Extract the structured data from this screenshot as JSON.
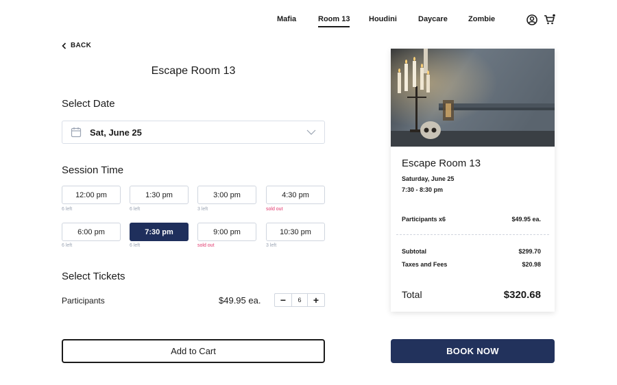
{
  "nav": {
    "items": [
      {
        "label": "Mafia"
      },
      {
        "label": "Room 13"
      },
      {
        "label": "Houdini"
      },
      {
        "label": "Daycare"
      },
      {
        "label": "Zombie"
      }
    ],
    "active": "Room 13",
    "icons": [
      "account-icon",
      "cart-icon"
    ]
  },
  "back_label": "BACK",
  "page_title": "Escape Room 13",
  "date_section": {
    "title": "Select Date",
    "selected": "Sat, June 25"
  },
  "session_section": {
    "title": "Session Time",
    "slots": [
      {
        "time": "12:00 pm",
        "note": "6 left",
        "status": "available"
      },
      {
        "time": "1:30 pm",
        "note": "6 left",
        "status": "available"
      },
      {
        "time": "3:00 pm",
        "note": "3 left",
        "status": "available"
      },
      {
        "time": "4:30 pm",
        "note": "sold out",
        "status": "sold-out"
      },
      {
        "time": "6:00 pm",
        "note": "6 left",
        "status": "available"
      },
      {
        "time": "7:30 pm",
        "note": "6 left",
        "status": "selected"
      },
      {
        "time": "9:00 pm",
        "note": "sold out",
        "status": "sold-out"
      },
      {
        "time": "10:30 pm",
        "note": "3 left",
        "status": "available"
      }
    ]
  },
  "tickets_section": {
    "title": "Select Tickets",
    "label": "Participants",
    "price": "$49.95 ea.",
    "quantity": "6",
    "minus": "−",
    "plus": "+"
  },
  "add_to_cart": "Add to Cart",
  "summary": {
    "title": "Escape Room 13",
    "date": "Saturday, June 25",
    "time": "7:30 - 8:30 pm",
    "participants_label": "Participants x6",
    "participants_price": "$49.95 ea.",
    "subtotal_label": "Subtotal",
    "subtotal_value": "$299.70",
    "taxes_label": "Taxes and Fees",
    "taxes_value": "$20.98",
    "total_label": "Total",
    "total_value": "$320.68"
  },
  "book_now": "BOOK NOW",
  "colors": {
    "primary": "#22325c",
    "sold_out": "#e0356b",
    "muted": "#9aa3b2"
  }
}
